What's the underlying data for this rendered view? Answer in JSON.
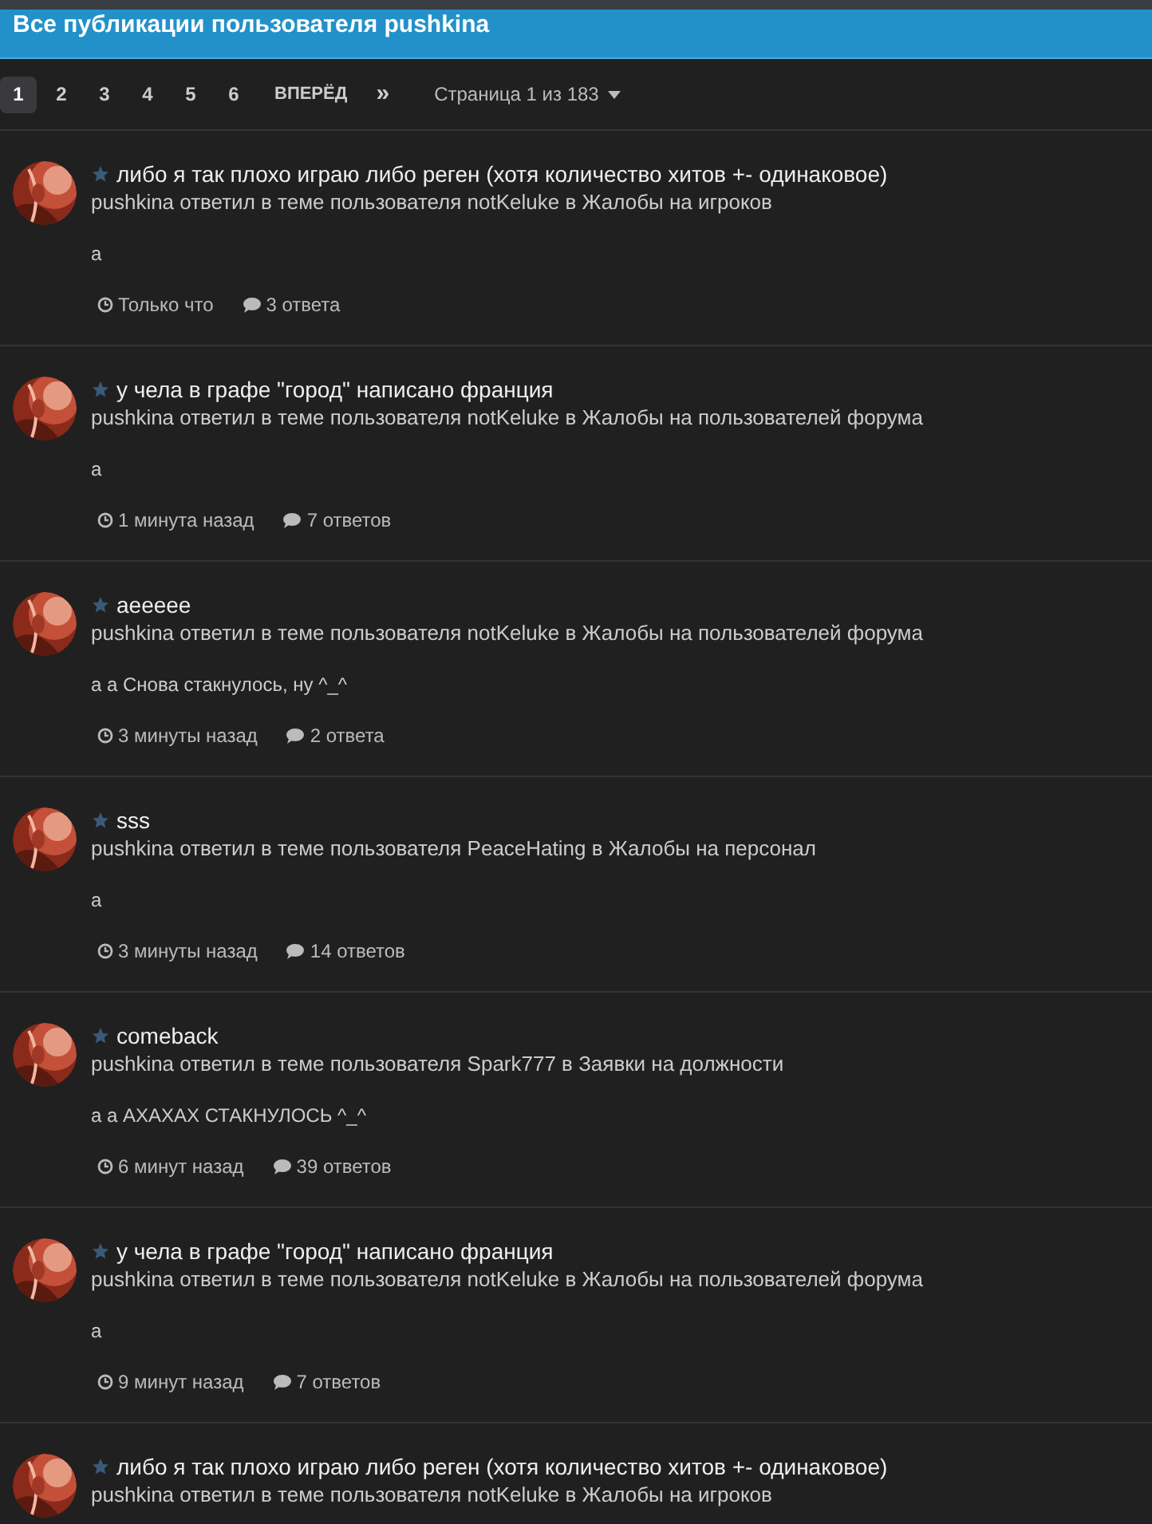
{
  "header": {
    "title": "Все публикации пользователя pushkina"
  },
  "pagination": {
    "pages": [
      {
        "label": "1",
        "selected": true
      },
      {
        "label": "2",
        "selected": false
      },
      {
        "label": "3",
        "selected": false
      },
      {
        "label": "4",
        "selected": false
      },
      {
        "label": "5",
        "selected": false
      },
      {
        "label": "6",
        "selected": false
      }
    ],
    "next": "ВПЕРЁД",
    "last": "»",
    "page_info": "Страница 1 из 183"
  },
  "posts": [
    {
      "title": "либо я так плохо играю либо реген (хотя количество хитов +- одинаковое)",
      "subtitle": "pushkina ответил в теме пользователя notKeluke в Жалобы на игроков",
      "body": "а",
      "time": "Только что",
      "replies": "3 ответа"
    },
    {
      "title": "у чела в графе \"город\" написано франция",
      "subtitle": "pushkina ответил в теме пользователя notKeluke в Жалобы на пользователей форума",
      "body": "а",
      "time": "1 минута назад",
      "replies": "7 ответов"
    },
    {
      "title": "aeeeee",
      "subtitle": "pushkina ответил в теме пользователя notKeluke в Жалобы на пользователей форума",
      "body": "а а Снова стакнулось, ну ^_^",
      "time": "3 минуты назад",
      "replies": "2 ответа"
    },
    {
      "title": "sss",
      "subtitle": "pushkina ответил в теме пользователя PeaceHating в Жалобы на персонал",
      "body": "а",
      "time": "3 минуты назад",
      "replies": "14 ответов"
    },
    {
      "title": "comeback",
      "subtitle": "pushkina ответил в теме пользователя Spark777 в Заявки на должности",
      "body": "а а АХАХАХ СТАКНУЛОСЬ ^_^",
      "time": "6 минут назад",
      "replies": "39 ответов"
    },
    {
      "title": "у чела в графе \"город\" написано франция",
      "subtitle": "pushkina ответил в теме пользователя notKeluke в Жалобы на пользователей форума",
      "body": "а",
      "time": "9 минут назад",
      "replies": "7 ответов"
    },
    {
      "title": "либо я так плохо играю либо реген (хотя количество хитов +- одинаковое)",
      "subtitle": "pushkina ответил в теме пользователя notKeluke в Жалобы на игроков"
    }
  ]
}
